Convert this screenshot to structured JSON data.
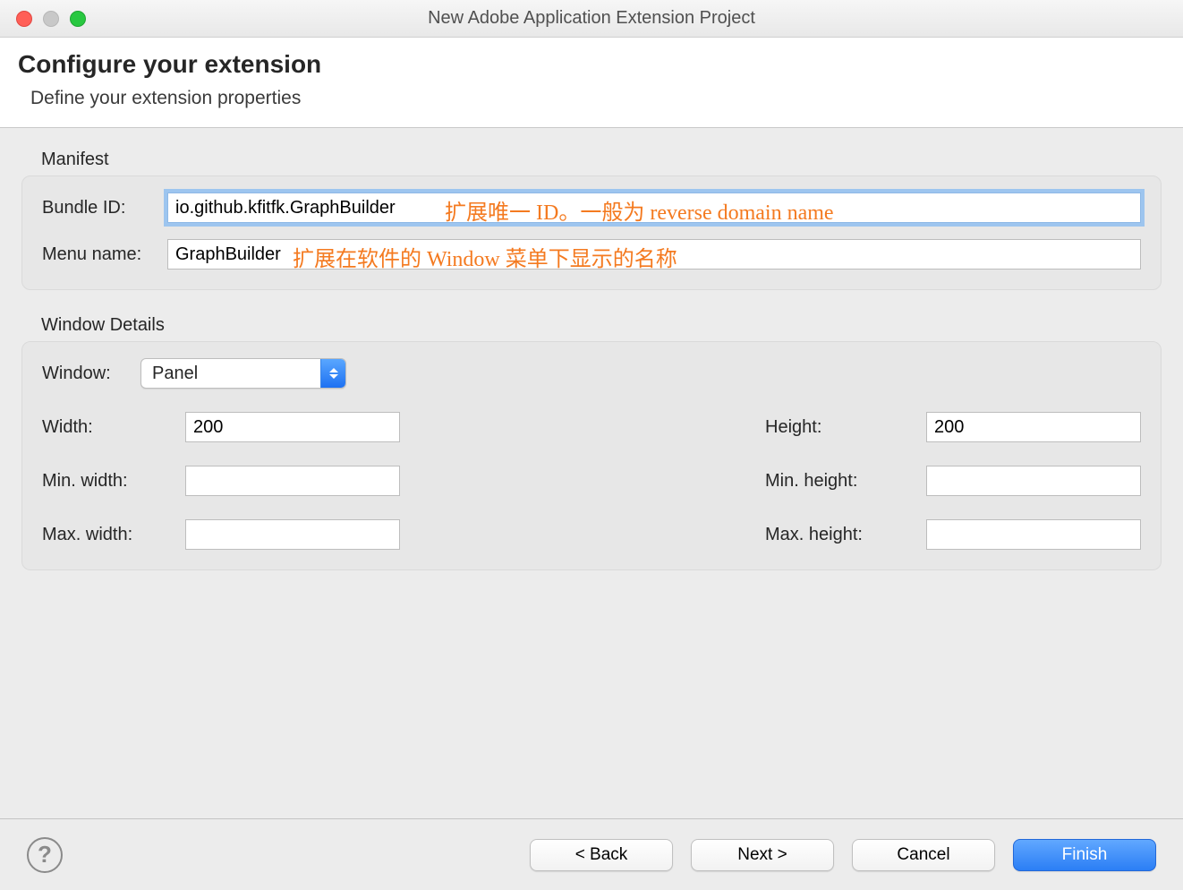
{
  "window": {
    "title": "New Adobe Application Extension Project"
  },
  "header": {
    "title": "Configure your extension",
    "subtitle": "Define your extension properties"
  },
  "manifest": {
    "section_label": "Manifest",
    "bundle_id_label": "Bundle ID:",
    "bundle_id_value": "io.github.kfitfk.GraphBuilder",
    "bundle_id_annotation": "扩展唯一 ID。一般为 reverse domain name",
    "menu_name_label": "Menu name:",
    "menu_name_value": "GraphBuilder",
    "menu_name_annotation": "扩展在软件的 Window 菜单下显示的名称"
  },
  "window_details": {
    "section_label": "Window Details",
    "window_label": "Window:",
    "window_value": "Panel",
    "width_label": "Width:",
    "width_value": "200",
    "height_label": "Height:",
    "height_value": "200",
    "min_width_label": "Min. width:",
    "min_width_value": "",
    "min_height_label": "Min. height:",
    "min_height_value": "",
    "max_width_label": "Max. width:",
    "max_width_value": "",
    "max_height_label": "Max. height:",
    "max_height_value": ""
  },
  "footer": {
    "help_label": "?",
    "back_label": "< Back",
    "next_label": "Next >",
    "cancel_label": "Cancel",
    "finish_label": "Finish"
  }
}
